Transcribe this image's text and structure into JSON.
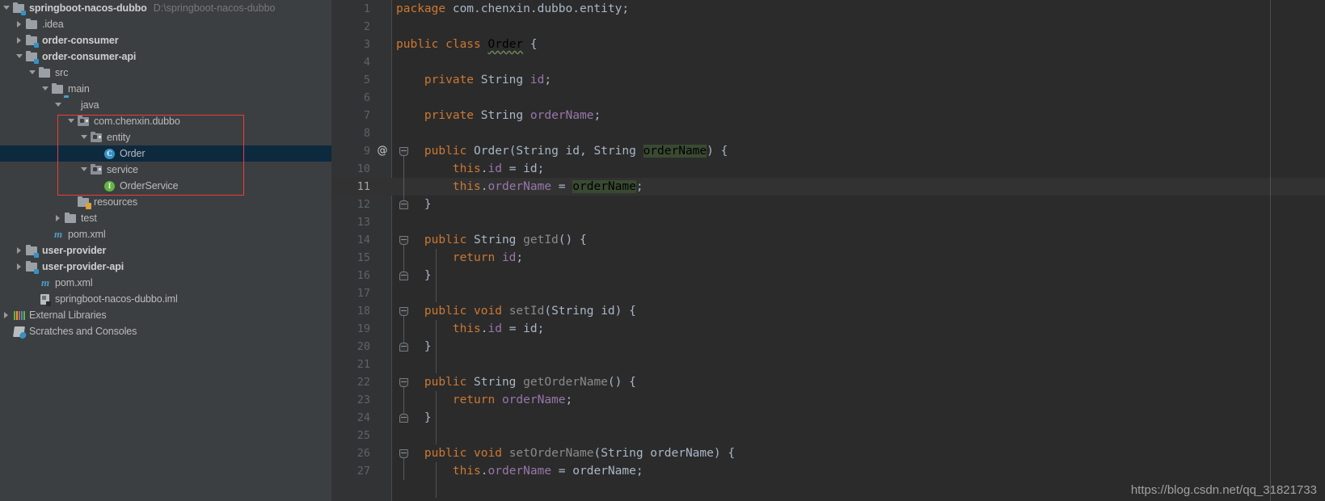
{
  "project": {
    "name": "springboot-nacos-dubbo",
    "path": "D:\\springboot-nacos-dubbo"
  },
  "tree": {
    "items": [
      {
        "label": "springboot-nacos-dubbo",
        "sublabel": "D:\\springboot-nacos-dubbo",
        "icon": "module-icon",
        "arrow": "expanded",
        "indent": 0,
        "bold": true,
        "selected": false
      },
      {
        "label": ".idea",
        "sublabel": "",
        "icon": "folder-icon",
        "arrow": "collapsed",
        "indent": 1,
        "bold": false,
        "selected": false
      },
      {
        "label": "order-consumer",
        "sublabel": "",
        "icon": "module-icon",
        "arrow": "collapsed",
        "indent": 1,
        "bold": true,
        "selected": false
      },
      {
        "label": "order-consumer-api",
        "sublabel": "",
        "icon": "module-icon",
        "arrow": "expanded",
        "indent": 1,
        "bold": true,
        "selected": false
      },
      {
        "label": "src",
        "sublabel": "",
        "icon": "folder-icon",
        "arrow": "expanded",
        "indent": 2,
        "bold": false,
        "selected": false
      },
      {
        "label": "main",
        "sublabel": "",
        "icon": "folder-icon",
        "arrow": "expanded",
        "indent": 3,
        "bold": false,
        "selected": false
      },
      {
        "label": "java",
        "sublabel": "",
        "icon": "source-folder-icon",
        "arrow": "expanded",
        "indent": 4,
        "bold": false,
        "selected": false
      },
      {
        "label": "com.chenxin.dubbo",
        "sublabel": "",
        "icon": "package-icon",
        "arrow": "expanded",
        "indent": 5,
        "bold": false,
        "selected": false
      },
      {
        "label": "entity",
        "sublabel": "",
        "icon": "package-icon",
        "arrow": "expanded",
        "indent": 6,
        "bold": false,
        "selected": false
      },
      {
        "label": "Order",
        "sublabel": "",
        "icon": "java-class-icon",
        "arrow": "none",
        "indent": 7,
        "bold": false,
        "selected": true
      },
      {
        "label": "service",
        "sublabel": "",
        "icon": "package-icon",
        "arrow": "expanded",
        "indent": 6,
        "bold": false,
        "selected": false
      },
      {
        "label": "OrderService",
        "sublabel": "",
        "icon": "java-interface-icon",
        "arrow": "none",
        "indent": 7,
        "bold": false,
        "selected": false
      },
      {
        "label": "resources",
        "sublabel": "",
        "icon": "resources-folder-icon",
        "arrow": "none",
        "indent": 5,
        "bold": false,
        "selected": false
      },
      {
        "label": "test",
        "sublabel": "",
        "icon": "folder-icon",
        "arrow": "collapsed",
        "indent": 4,
        "bold": false,
        "selected": false
      },
      {
        "label": "pom.xml",
        "sublabel": "",
        "icon": "maven-icon",
        "arrow": "none",
        "indent": 3,
        "bold": false,
        "selected": false
      },
      {
        "label": "user-provider",
        "sublabel": "",
        "icon": "module-icon",
        "arrow": "collapsed",
        "indent": 1,
        "bold": true,
        "selected": false
      },
      {
        "label": "user-provider-api",
        "sublabel": "",
        "icon": "module-icon",
        "arrow": "collapsed",
        "indent": 1,
        "bold": true,
        "selected": false
      },
      {
        "label": "pom.xml",
        "sublabel": "",
        "icon": "maven-icon",
        "arrow": "none",
        "indent": 2,
        "bold": false,
        "selected": false
      },
      {
        "label": "springboot-nacos-dubbo.iml",
        "sublabel": "",
        "icon": "iml-file-icon",
        "arrow": "none",
        "indent": 2,
        "bold": false,
        "selected": false
      },
      {
        "label": "External Libraries",
        "sublabel": "",
        "icon": "external-libraries-icon",
        "arrow": "collapsed",
        "indent": 0,
        "bold": false,
        "selected": false
      },
      {
        "label": "Scratches and Consoles",
        "sublabel": "",
        "icon": "scratches-icon",
        "arrow": "none",
        "indent": 0,
        "bold": false,
        "selected": false
      }
    ]
  },
  "editor": {
    "caret_line": 11,
    "annotation_gutter_line": 9,
    "annotation_gutter_glyph": "@",
    "lines": [
      {
        "n": 1,
        "fold": "open-none",
        "tokens": [
          [
            "kw",
            "package"
          ],
          [
            "pun",
            " com.chenxin.dubbo.entity;"
          ]
        ]
      },
      {
        "n": 2,
        "fold": "none",
        "tokens": []
      },
      {
        "n": 3,
        "fold": "none",
        "tokens": [
          [
            "kw",
            "public "
          ],
          [
            "kw",
            "class "
          ],
          [
            "wavy",
            "Order"
          ],
          [
            "pun",
            " {"
          ]
        ]
      },
      {
        "n": 4,
        "fold": "none",
        "tokens": []
      },
      {
        "n": 5,
        "fold": "none",
        "tokens": [
          [
            "pun",
            "    "
          ],
          [
            "kw",
            "private "
          ],
          [
            "type",
            "String "
          ],
          [
            "fld",
            "id"
          ],
          [
            "pun",
            ";"
          ]
        ]
      },
      {
        "n": 6,
        "fold": "none",
        "tokens": []
      },
      {
        "n": 7,
        "fold": "none",
        "tokens": [
          [
            "pun",
            "    "
          ],
          [
            "kw",
            "private "
          ],
          [
            "type",
            "String "
          ],
          [
            "fld",
            "orderName"
          ],
          [
            "pun",
            ";"
          ]
        ]
      },
      {
        "n": 8,
        "fold": "none",
        "tokens": []
      },
      {
        "n": 9,
        "fold": "open",
        "tokens": [
          [
            "pun",
            "    "
          ],
          [
            "kw",
            "public "
          ],
          [
            "cls",
            "Order"
          ],
          [
            "pun",
            "("
          ],
          [
            "type",
            "String "
          ],
          [
            "pun",
            "id, "
          ],
          [
            "type",
            "String "
          ],
          [
            "hl",
            "orderName"
          ],
          [
            "pun",
            ") {"
          ]
        ]
      },
      {
        "n": 10,
        "fold": "bar",
        "tokens": [
          [
            "pun",
            "        "
          ],
          [
            "kw",
            "this"
          ],
          [
            "pun",
            "."
          ],
          [
            "fld",
            "id"
          ],
          [
            "pun",
            " = id;"
          ]
        ]
      },
      {
        "n": 11,
        "fold": "bar",
        "tokens": [
          [
            "pun",
            "        "
          ],
          [
            "kw",
            "this"
          ],
          [
            "pun",
            "."
          ],
          [
            "fld",
            "orderName"
          ],
          [
            "pun",
            " = "
          ],
          [
            "hl",
            "orderName"
          ],
          [
            "pun",
            ";"
          ]
        ]
      },
      {
        "n": 12,
        "fold": "close",
        "tokens": [
          [
            "pun",
            "    }"
          ]
        ]
      },
      {
        "n": 13,
        "fold": "none",
        "tokens": []
      },
      {
        "n": 14,
        "fold": "open",
        "tokens": [
          [
            "pun",
            "    "
          ],
          [
            "kw",
            "public "
          ],
          [
            "type",
            "String "
          ],
          [
            "meth",
            "getId"
          ],
          [
            "pun",
            "() {"
          ]
        ]
      },
      {
        "n": 15,
        "fold": "bar",
        "tokens": [
          [
            "pun",
            "        "
          ],
          [
            "kw",
            "return "
          ],
          [
            "fld",
            "id"
          ],
          [
            "pun",
            ";"
          ]
        ]
      },
      {
        "n": 16,
        "fold": "close",
        "tokens": [
          [
            "pun",
            "    }"
          ]
        ]
      },
      {
        "n": 17,
        "fold": "none",
        "tokens": []
      },
      {
        "n": 18,
        "fold": "open",
        "tokens": [
          [
            "pun",
            "    "
          ],
          [
            "kw",
            "public "
          ],
          [
            "kw",
            "void "
          ],
          [
            "meth",
            "setId"
          ],
          [
            "pun",
            "("
          ],
          [
            "type",
            "String "
          ],
          [
            "pun",
            "id) {"
          ]
        ]
      },
      {
        "n": 19,
        "fold": "bar",
        "tokens": [
          [
            "pun",
            "        "
          ],
          [
            "kw",
            "this"
          ],
          [
            "pun",
            "."
          ],
          [
            "fld",
            "id"
          ],
          [
            "pun",
            " = id;"
          ]
        ]
      },
      {
        "n": 20,
        "fold": "close",
        "tokens": [
          [
            "pun",
            "    }"
          ]
        ]
      },
      {
        "n": 21,
        "fold": "none",
        "tokens": []
      },
      {
        "n": 22,
        "fold": "open",
        "tokens": [
          [
            "pun",
            "    "
          ],
          [
            "kw",
            "public "
          ],
          [
            "type",
            "String "
          ],
          [
            "meth",
            "getOrderName"
          ],
          [
            "pun",
            "() {"
          ]
        ]
      },
      {
        "n": 23,
        "fold": "bar",
        "tokens": [
          [
            "pun",
            "        "
          ],
          [
            "kw",
            "return "
          ],
          [
            "fld",
            "orderName"
          ],
          [
            "pun",
            ";"
          ]
        ]
      },
      {
        "n": 24,
        "fold": "close",
        "tokens": [
          [
            "pun",
            "    }"
          ]
        ]
      },
      {
        "n": 25,
        "fold": "none",
        "tokens": []
      },
      {
        "n": 26,
        "fold": "open",
        "tokens": [
          [
            "pun",
            "    "
          ],
          [
            "kw",
            "public "
          ],
          [
            "kw",
            "void "
          ],
          [
            "meth",
            "setOrderName"
          ],
          [
            "pun",
            "("
          ],
          [
            "type",
            "String "
          ],
          [
            "pun",
            "orderName) {"
          ]
        ]
      },
      {
        "n": 27,
        "fold": "bar",
        "tokens": [
          [
            "pun",
            "        "
          ],
          [
            "kw",
            "this"
          ],
          [
            "pun",
            "."
          ],
          [
            "fld",
            "orderName"
          ],
          [
            "pun",
            " = orderName;"
          ]
        ]
      }
    ]
  },
  "watermark": {
    "text": "https://blog.csdn.net/qq_31821733"
  },
  "colors": {
    "tree_bg": "#3c3f41",
    "editor_bg": "#2b2b2b",
    "gutter_bg": "#313335",
    "selection_bg": "#0d293e",
    "caret_line_bg": "#323232",
    "annotation_red": "#f03c3c",
    "keyword": "#cc7832",
    "field": "#9876aa",
    "text": "#a9b7c6",
    "method": "#8a8a8a",
    "usage_highlight": "#3a4a32"
  }
}
